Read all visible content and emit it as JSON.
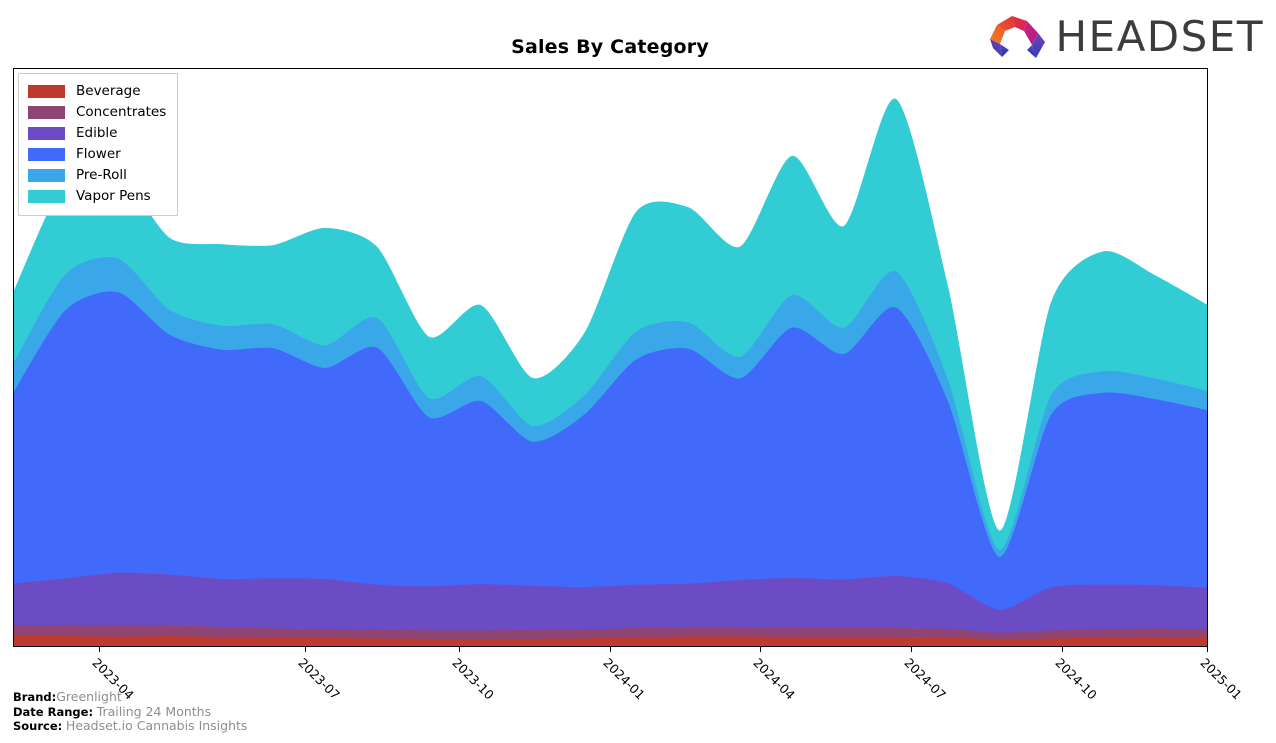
{
  "header": {
    "title": "Sales By Category",
    "logo_text": "HEADSET",
    "logo_icon": "headset-logo-icon"
  },
  "legend": {
    "position": "top-left",
    "items": [
      {
        "label": "Beverage",
        "color": "#c0392f"
      },
      {
        "label": "Concentrates",
        "color": "#8e4573"
      },
      {
        "label": "Edible",
        "color": "#6c4cc4"
      },
      {
        "label": "Flower",
        "color": "#4169fa"
      },
      {
        "label": "Pre-Roll",
        "color": "#3aa8e8"
      },
      {
        "label": "Vapor Pens",
        "color": "#31ccd4"
      }
    ]
  },
  "footer": {
    "rows": [
      {
        "key": "Brand:",
        "value": "Greenlight"
      },
      {
        "key": "Date Range:",
        "value": "Trailing 24 Months"
      },
      {
        "key": "Source:",
        "value": "Headset.io Cannabis Insights"
      }
    ]
  },
  "chart_data": {
    "type": "area",
    "stacked": true,
    "smoothing": "spline",
    "title": "Sales By Category",
    "xlabel": "",
    "ylabel": "",
    "grid": false,
    "legend_position": "top-left",
    "axis": {
      "x_tick_labels": [
        "2023-04",
        "2023-07",
        "2023-10",
        "2024-01",
        "2024-04",
        "2024-07",
        "2024-10",
        "2025-01"
      ],
      "x_tick_fractions": [
        0.0712,
        0.2443,
        0.3728,
        0.4992,
        0.6256,
        0.752,
        0.8785,
        1.0
      ],
      "y_axis_visible": false,
      "y_range_relative": [
        0,
        1
      ]
    },
    "x": [
      "2023-02",
      "2023-03",
      "2023-04",
      "2023-05",
      "2023-06",
      "2023-07",
      "2023-08",
      "2023-09",
      "2023-10",
      "2023-11",
      "2023-12",
      "2024-01",
      "2024-02",
      "2024-03",
      "2024-04",
      "2024-05",
      "2024-06",
      "2024-07",
      "2024-08",
      "2024-09",
      "2024-10",
      "2024-11",
      "2024-12",
      "2025-01"
    ],
    "series": [
      {
        "name": "Beverage",
        "color": "#c0392f",
        "values": [
          0.022,
          0.02,
          0.019,
          0.02,
          0.018,
          0.016,
          0.016,
          0.015,
          0.014,
          0.014,
          0.014,
          0.015,
          0.017,
          0.019,
          0.019,
          0.018,
          0.018,
          0.018,
          0.017,
          0.013,
          0.015,
          0.017,
          0.018,
          0.018
        ]
      },
      {
        "name": "Concentrates",
        "color": "#8e4573",
        "values": [
          0.02,
          0.022,
          0.023,
          0.022,
          0.021,
          0.02,
          0.019,
          0.019,
          0.018,
          0.018,
          0.019,
          0.019,
          0.02,
          0.02,
          0.02,
          0.019,
          0.019,
          0.019,
          0.018,
          0.014,
          0.017,
          0.018,
          0.018,
          0.017
        ]
      },
      {
        "name": "Edible",
        "color": "#6c4cc4",
        "values": [
          0.088,
          0.098,
          0.11,
          0.106,
          0.1,
          0.104,
          0.104,
          0.093,
          0.092,
          0.096,
          0.092,
          0.088,
          0.09,
          0.09,
          0.098,
          0.104,
          0.101,
          0.108,
          0.095,
          0.048,
          0.09,
          0.092,
          0.09,
          0.086
        ]
      },
      {
        "name": "Flower",
        "color": "#4169fa",
        "values": [
          0.4,
          0.56,
          0.585,
          0.5,
          0.478,
          0.48,
          0.44,
          0.494,
          0.352,
          0.382,
          0.3,
          0.36,
          0.47,
          0.49,
          0.42,
          0.522,
          0.47,
          0.56,
          0.38,
          0.11,
          0.36,
          0.4,
          0.388,
          0.37
        ]
      },
      {
        "name": "Pre-Roll",
        "color": "#3aa8e8",
        "values": [
          0.06,
          0.075,
          0.07,
          0.052,
          0.05,
          0.05,
          0.047,
          0.062,
          0.04,
          0.052,
          0.033,
          0.04,
          0.058,
          0.055,
          0.045,
          0.068,
          0.055,
          0.075,
          0.045,
          0.015,
          0.04,
          0.045,
          0.043,
          0.04
        ]
      },
      {
        "name": "Vapor Pens",
        "color": "#31ccd4",
        "values": [
          0.15,
          0.195,
          0.178,
          0.15,
          0.17,
          0.165,
          0.245,
          0.148,
          0.128,
          0.148,
          0.1,
          0.13,
          0.25,
          0.24,
          0.23,
          0.29,
          0.212,
          0.36,
          0.195,
          0.04,
          0.195,
          0.25,
          0.215,
          0.18
        ]
      }
    ]
  }
}
